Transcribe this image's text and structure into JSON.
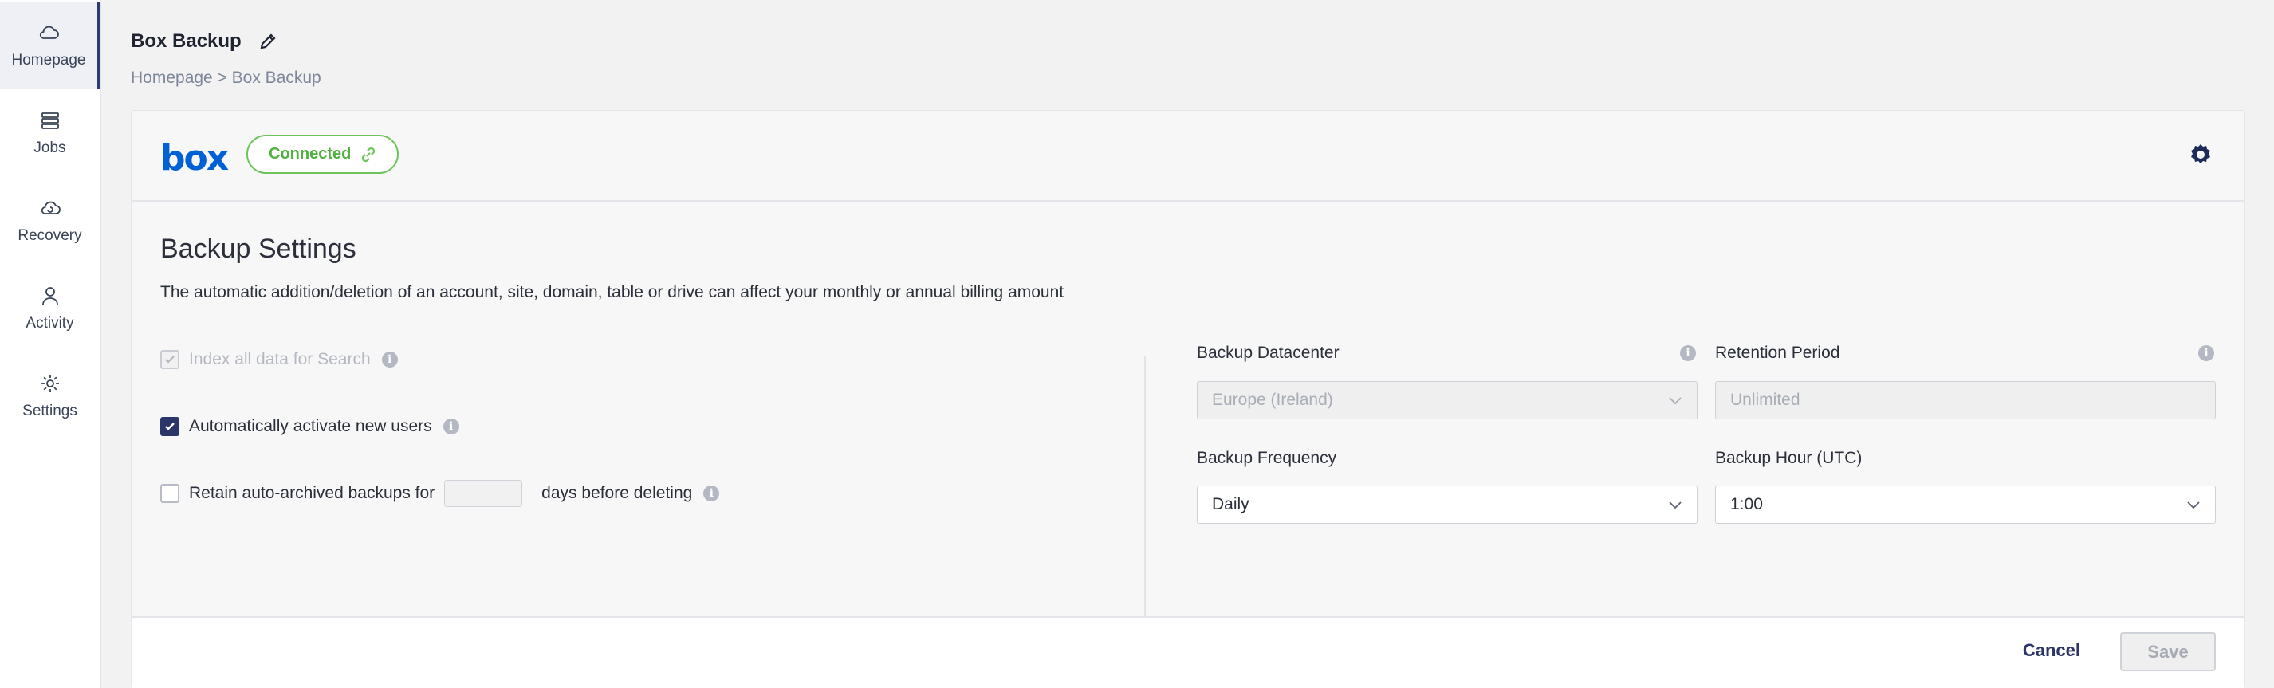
{
  "sidebar": {
    "items": [
      {
        "label": "Homepage",
        "icon": "cloud-icon",
        "active": true
      },
      {
        "label": "Jobs",
        "icon": "stack-icon"
      },
      {
        "label": "Recovery",
        "icon": "cloud-refresh-icon"
      },
      {
        "label": "Activity",
        "icon": "user-icon"
      },
      {
        "label": "Settings",
        "icon": "gear-icon"
      }
    ]
  },
  "header": {
    "title": "Box Backup",
    "breadcrumb": "Homepage > Box Backup"
  },
  "card": {
    "logo_text": "box",
    "status": "Connected",
    "section_title": "Backup Settings",
    "description": "The automatic addition/deletion of an account, site, domain, table or drive can affect your monthly or annual billing amount",
    "options": {
      "index_search": "Index all data for Search",
      "auto_activate": "Automatically activate new users",
      "retain_prefix": "Retain auto-archived backups for",
      "retain_suffix": "days before deleting"
    },
    "fields": {
      "datacenter_label": "Backup Datacenter",
      "datacenter_value": "Europe (Ireland)",
      "retention_label": "Retention Period",
      "retention_value": "Unlimited",
      "frequency_label": "Backup Frequency",
      "frequency_value": "Daily",
      "hour_label": "Backup Hour (UTC)",
      "hour_value": "1:00"
    },
    "cancel_label": "Cancel",
    "save_label": "Save"
  },
  "colors": {
    "accent": "#2c3568",
    "box_blue": "#0061d5",
    "connected_green": "#6dc45a"
  }
}
